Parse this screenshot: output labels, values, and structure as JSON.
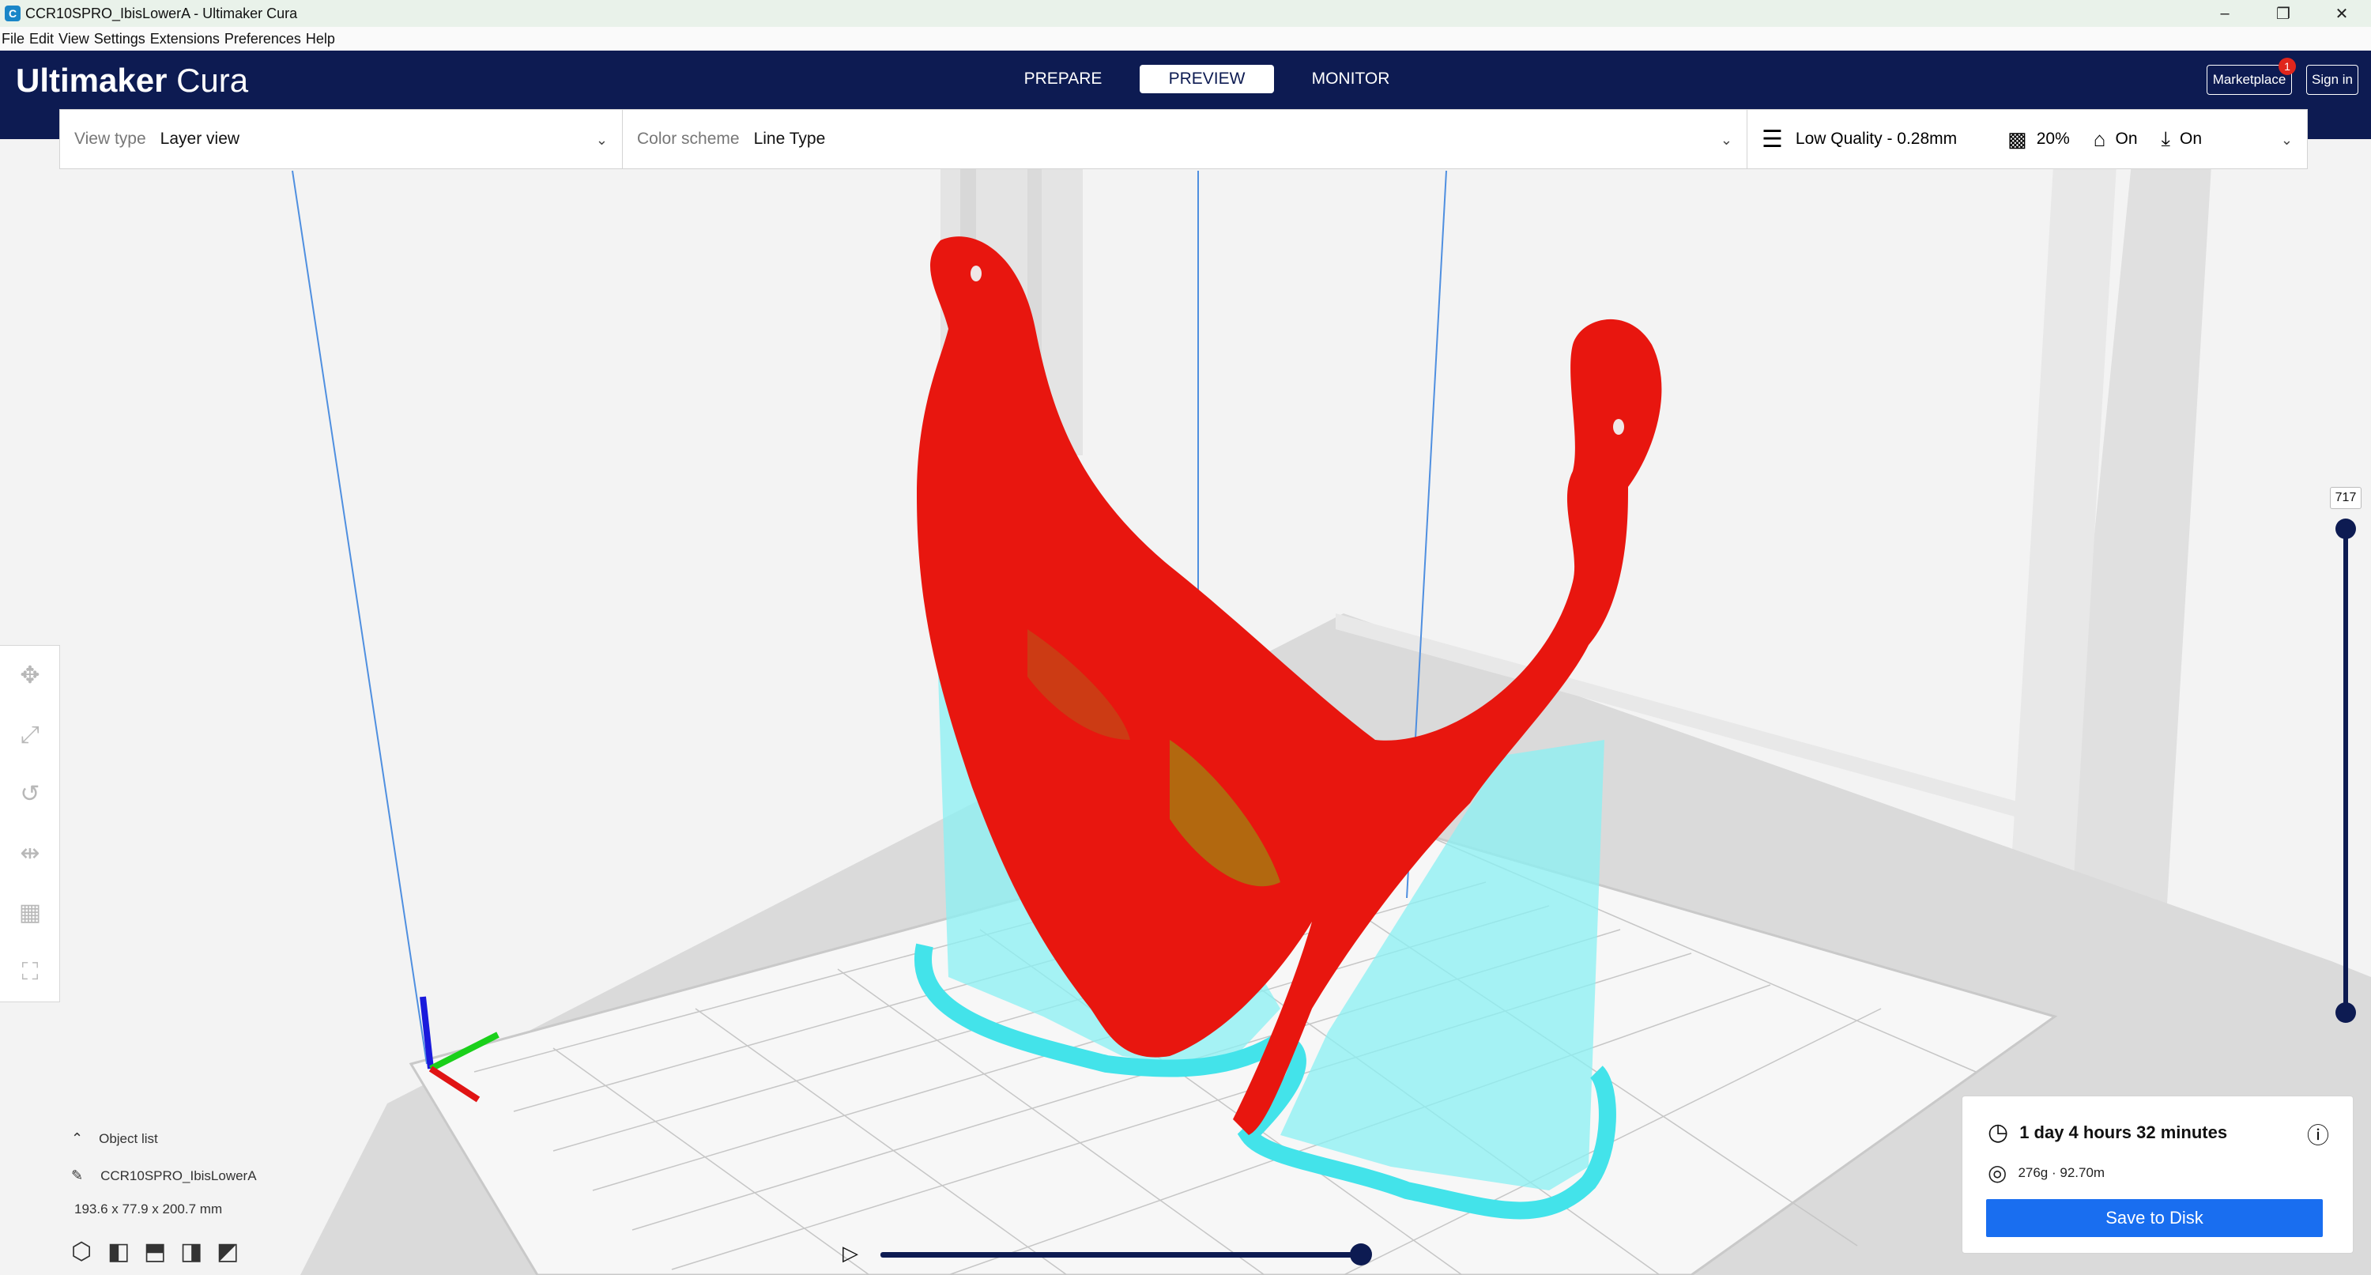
{
  "window": {
    "title": "CCR10SPRO_IbisLowerA - Ultimaker Cura",
    "controls": [
      "–",
      "❐",
      "✕"
    ]
  },
  "menu": [
    "File",
    "Edit",
    "View",
    "Settings",
    "Extensions",
    "Preferences",
    "Help"
  ],
  "header": {
    "logo_bold": "Ultimaker",
    "logo_light": "Cura",
    "stages": [
      {
        "label": "PREPARE",
        "active": false
      },
      {
        "label": "PREVIEW",
        "active": true
      },
      {
        "label": "MONITOR",
        "active": false
      }
    ],
    "marketplace_label": "Marketplace",
    "marketplace_badge": "1",
    "signin_label": "Sign in"
  },
  "toolbar": {
    "view_type_label": "View type",
    "view_type_value": "Layer view",
    "color_scheme_label": "Color scheme",
    "color_scheme_value": "Line Type",
    "quality": "Low Quality - 0.28mm",
    "infill": "20%",
    "support": "On",
    "adhesion": "On"
  },
  "layer_slider": {
    "value": "717"
  },
  "object_list": {
    "label": "Object list",
    "object_name": "CCR10SPRO_IbisLowerA",
    "dimensions": "193.6 x 77.9 x 200.7 mm"
  },
  "print_info": {
    "time": "1 day 4 hours 32 minutes",
    "material": "276g · 92.70m",
    "save_label": "Save to Disk"
  },
  "colors": {
    "header_bg": "#0d1b52",
    "accent_blue": "#196ef0",
    "model_red": "#e8160f",
    "support_cyan": "#7fe9ef"
  }
}
